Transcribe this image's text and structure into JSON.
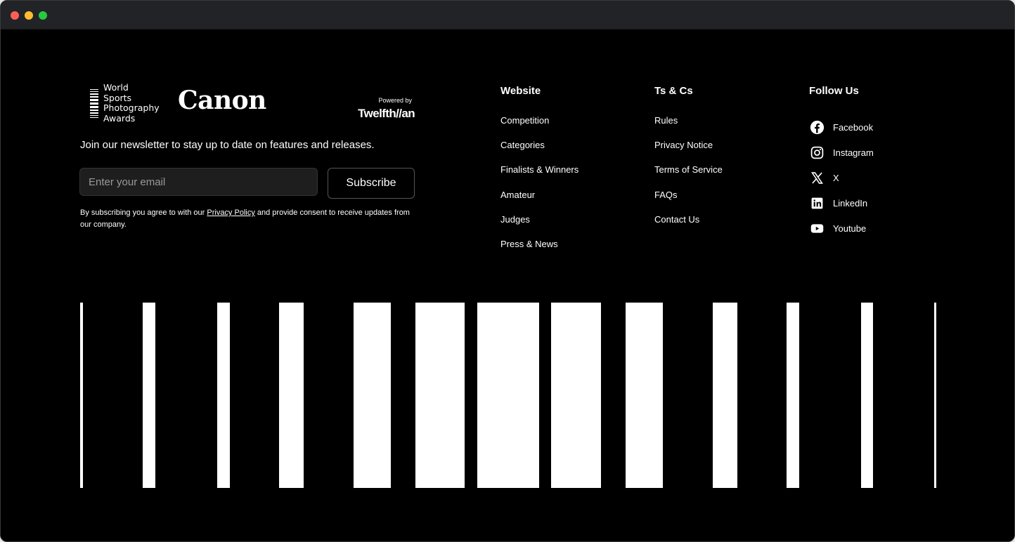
{
  "logos": {
    "wspa_lines": [
      "World",
      "Sports",
      "Photography",
      "Awards"
    ],
    "canon": "Canon",
    "powered_by": "Powered by",
    "twelfthman": "Twelfth//an"
  },
  "newsletter": {
    "text": "Join our newsletter to stay up to date on features and releases.",
    "email_placeholder": "Enter your email",
    "subscribe_label": "Subscribe",
    "consent_before": "By subscribing you agree to with our ",
    "consent_link": "Privacy Policy",
    "consent_after": " and provide consent to receive updates from our company."
  },
  "website": {
    "title": "Website",
    "items": [
      "Competition",
      "Categories",
      "Finalists & Winners",
      "Amateur",
      "Judges",
      "Press & News"
    ]
  },
  "ts": {
    "title": "Ts & Cs",
    "items": [
      "Rules",
      "Privacy Notice",
      "Terms of Service",
      "FAQs",
      "Contact Us"
    ]
  },
  "follow": {
    "title": "Follow Us",
    "items": [
      {
        "label": "Facebook",
        "icon": "facebook-icon"
      },
      {
        "label": "Instagram",
        "icon": "instagram-icon"
      },
      {
        "label": "X",
        "icon": "x-icon"
      },
      {
        "label": "LinkedIn",
        "icon": "linkedin-icon"
      },
      {
        "label": "Youtube",
        "icon": "youtube-icon"
      }
    ]
  },
  "colors": {
    "background": "#000000",
    "foreground": "#ffffff",
    "input_bg": "#1e1e1e"
  }
}
